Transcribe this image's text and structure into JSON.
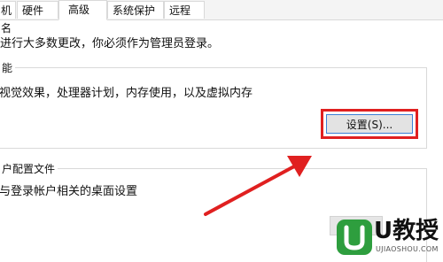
{
  "tabs": [
    {
      "label": "机名",
      "active": false
    },
    {
      "label": "硬件",
      "active": false
    },
    {
      "label": "高级",
      "active": true
    },
    {
      "label": "系统保护",
      "active": false
    },
    {
      "label": "远程",
      "active": false
    }
  ],
  "notice": "进行大多数更改，你必须作为管理员登录。",
  "performance": {
    "legend": "能",
    "description": "视觉效果，处理器计划，内存使用，以及虚拟内存",
    "settings_button": "设置(S)..."
  },
  "user_profiles": {
    "legend": "户配置文件",
    "description": "与登录帐户相关的桌面设置"
  },
  "highlight_color": "#e02020",
  "watermark": {
    "icon": "u-logo-icon",
    "brand": "U教授",
    "url": "UJIAOSHOU.COM"
  }
}
